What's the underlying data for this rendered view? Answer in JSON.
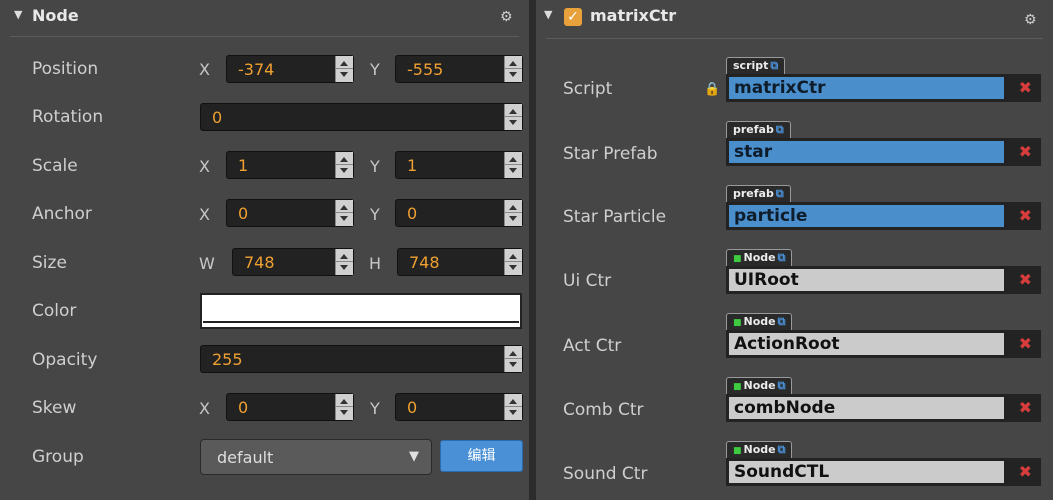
{
  "node_panel": {
    "title": "Node",
    "fold_icon": "collapse-triangle-icon",
    "settings_icon": "gear-icon",
    "rows": {
      "position": {
        "label": "Position",
        "x_axis": "X",
        "x": "-374",
        "y_axis": "Y",
        "y": "-555"
      },
      "rotation": {
        "label": "Rotation",
        "value": "0"
      },
      "scale": {
        "label": "Scale",
        "x_axis": "X",
        "x": "1",
        "y_axis": "Y",
        "y": "1"
      },
      "anchor": {
        "label": "Anchor",
        "x_axis": "X",
        "x": "0",
        "y_axis": "Y",
        "y": "0"
      },
      "size": {
        "label": "Size",
        "w_axis": "W",
        "w": "748",
        "h_axis": "H",
        "h": "748"
      },
      "color": {
        "label": "Color",
        "value": "#ffffff"
      },
      "opacity": {
        "label": "Opacity",
        "value": "255"
      },
      "skew": {
        "label": "Skew",
        "x_axis": "X",
        "x": "0",
        "y_axis": "Y",
        "y": "0"
      },
      "group": {
        "label": "Group",
        "value": "default",
        "edit_label": "编辑"
      }
    }
  },
  "component_panel": {
    "title": "matrixCtr",
    "enabled": true,
    "settings_icon": "gear-icon",
    "props": [
      {
        "label": "Script",
        "tag": "script",
        "value": "matrixCtr",
        "kind": "asset"
      },
      {
        "label": "Star Prefab",
        "tag": "prefab",
        "value": "star",
        "kind": "asset"
      },
      {
        "label": "Star Particle",
        "tag": "prefab",
        "value": "particle",
        "kind": "asset"
      },
      {
        "label": "Ui Ctr",
        "tag": "Node",
        "value": "UIRoot",
        "kind": "node"
      },
      {
        "label": "Act Ctr",
        "tag": "Node",
        "value": "ActionRoot",
        "kind": "node"
      },
      {
        "label": "Comb Ctr",
        "tag": "Node",
        "value": "combNode",
        "kind": "node"
      },
      {
        "label": "Sound Ctr",
        "tag": "Node",
        "value": "SoundCTL",
        "kind": "node"
      }
    ]
  },
  "colors": {
    "accent_orange": "#f0a030",
    "asset_blue": "#4a8fcc",
    "clear_red": "#d63c3c",
    "node_green": "#3ecc3e"
  }
}
